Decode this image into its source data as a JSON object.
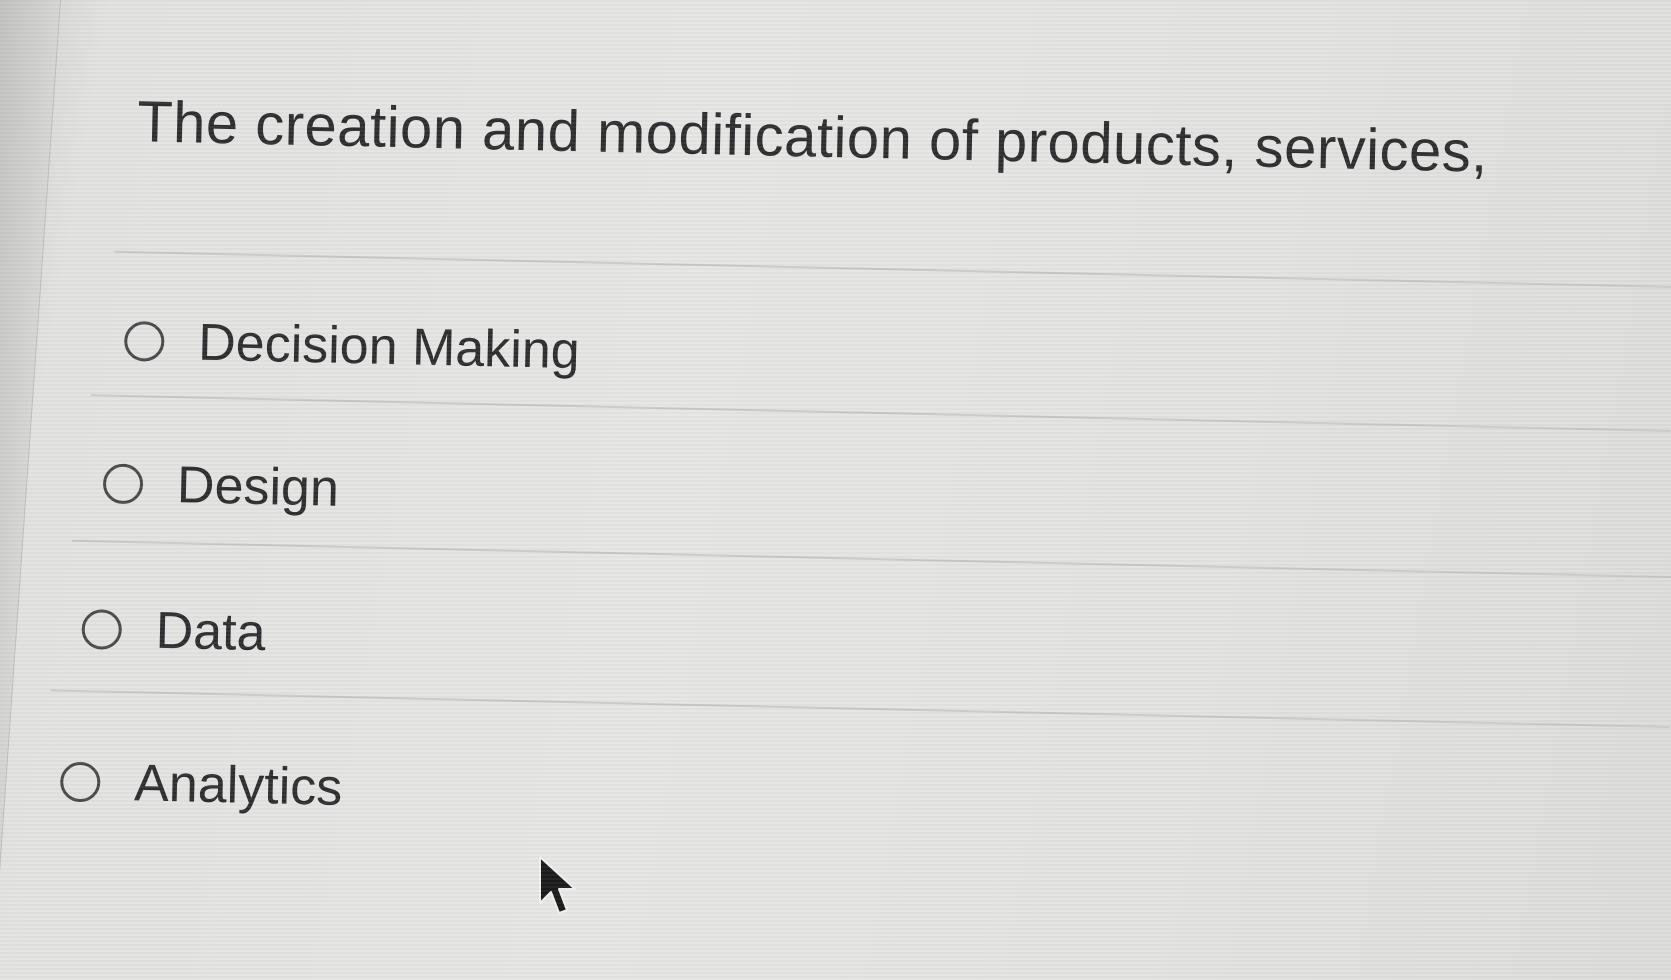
{
  "question": {
    "text": "The creation and modification of products, services,"
  },
  "options": [
    {
      "label": "Decision Making"
    },
    {
      "label": "Design"
    },
    {
      "label": "Data"
    },
    {
      "label": "Analytics"
    }
  ],
  "colors": {
    "background": "#e4e4e2",
    "text": "#2e2e30",
    "divider": "#c9c9c7"
  }
}
